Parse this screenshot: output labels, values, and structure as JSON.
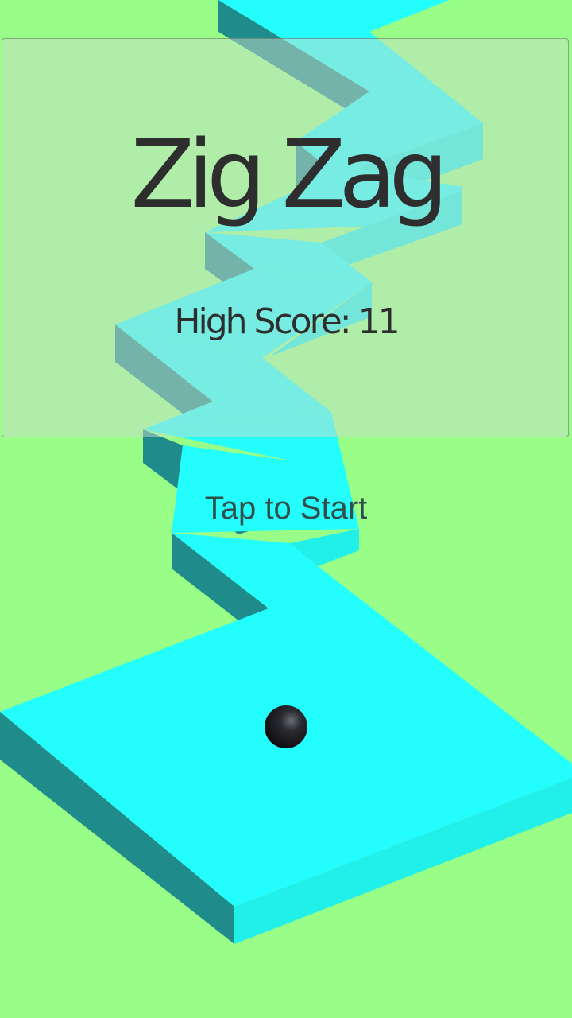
{
  "game": {
    "title": "Zig Zag",
    "high_score_label": "High Score:",
    "high_score_value": "11",
    "high_score_text": "High Score: 11",
    "prompt": "Tap to Start"
  },
  "colors": {
    "background": "#99fe88",
    "path_top": "#24fdfd",
    "path_side_left": "#1f8b8a",
    "path_side_right": "#20efea",
    "ball": "#1a1a1c",
    "text": "#2e2e2e",
    "panel": "rgba(200,220,200,0.5)"
  }
}
